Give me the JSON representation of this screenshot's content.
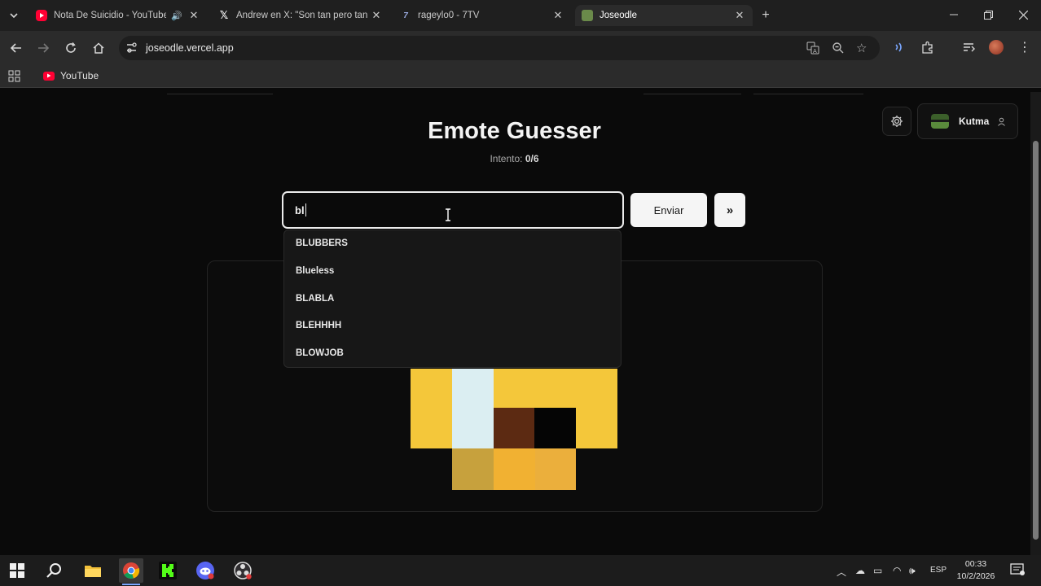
{
  "tabs": [
    {
      "title": "Nota De Suicidio - YouTube",
      "favicon": "youtube-icon"
    },
    {
      "title": "Andrew en X: \"Son tan pero tan",
      "favicon": "x-icon"
    },
    {
      "title": "rageylo0 - 7TV",
      "favicon": "7tv-icon"
    },
    {
      "title": "Joseodle",
      "favicon": "joseodle-icon"
    }
  ],
  "address_bar": {
    "url": "joseodle.vercel.app"
  },
  "bookmarks": [
    {
      "label": "YouTube"
    }
  ],
  "app": {
    "title": "Emote Guesser",
    "attempt_label": "Intento:",
    "attempt_value": "0/6",
    "user_name": "Kutma"
  },
  "guess": {
    "input_value": "bl",
    "submit_label": "Enviar",
    "skip_label": "»",
    "suggestions": [
      "BLUBBERS",
      "Blueless",
      "BLABLA",
      "BLEHHHH",
      "BLOWJOB"
    ]
  },
  "emote_preview": {
    "colors": {
      "yellow": "#f4c73a",
      "light": "#dbeef2",
      "brown": "#5c2a12",
      "black": "#050505",
      "olive": "#c7a13d",
      "orange": "#f1b132"
    }
  },
  "taskbar": {
    "language": "ESP",
    "time": "00:33",
    "date": "10/2/2026"
  }
}
